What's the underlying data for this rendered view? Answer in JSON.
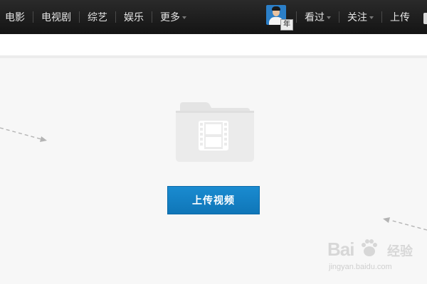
{
  "nav": {
    "left_items": [
      {
        "label": "电影",
        "has_caret": false
      },
      {
        "label": "电视剧",
        "has_caret": false
      },
      {
        "label": "综艺",
        "has_caret": false
      },
      {
        "label": "娱乐",
        "has_caret": false
      },
      {
        "label": "更多",
        "has_caret": true
      }
    ],
    "avatar_badge": "年",
    "right_items": [
      {
        "label": "看过",
        "has_caret": true
      },
      {
        "label": "关注",
        "has_caret": true
      },
      {
        "label": "上传",
        "has_caret": false
      }
    ]
  },
  "main": {
    "upload_button_label": "上传视频",
    "folder_icon": "film-folder-icon"
  },
  "watermark": {
    "brand": "Bai",
    "brand_cn": "经验",
    "url": "jingyan.baidu.com"
  },
  "colors": {
    "topbar": "#1c1c1c",
    "accent_button": "#1480c4",
    "background": "#f7f7f7"
  }
}
